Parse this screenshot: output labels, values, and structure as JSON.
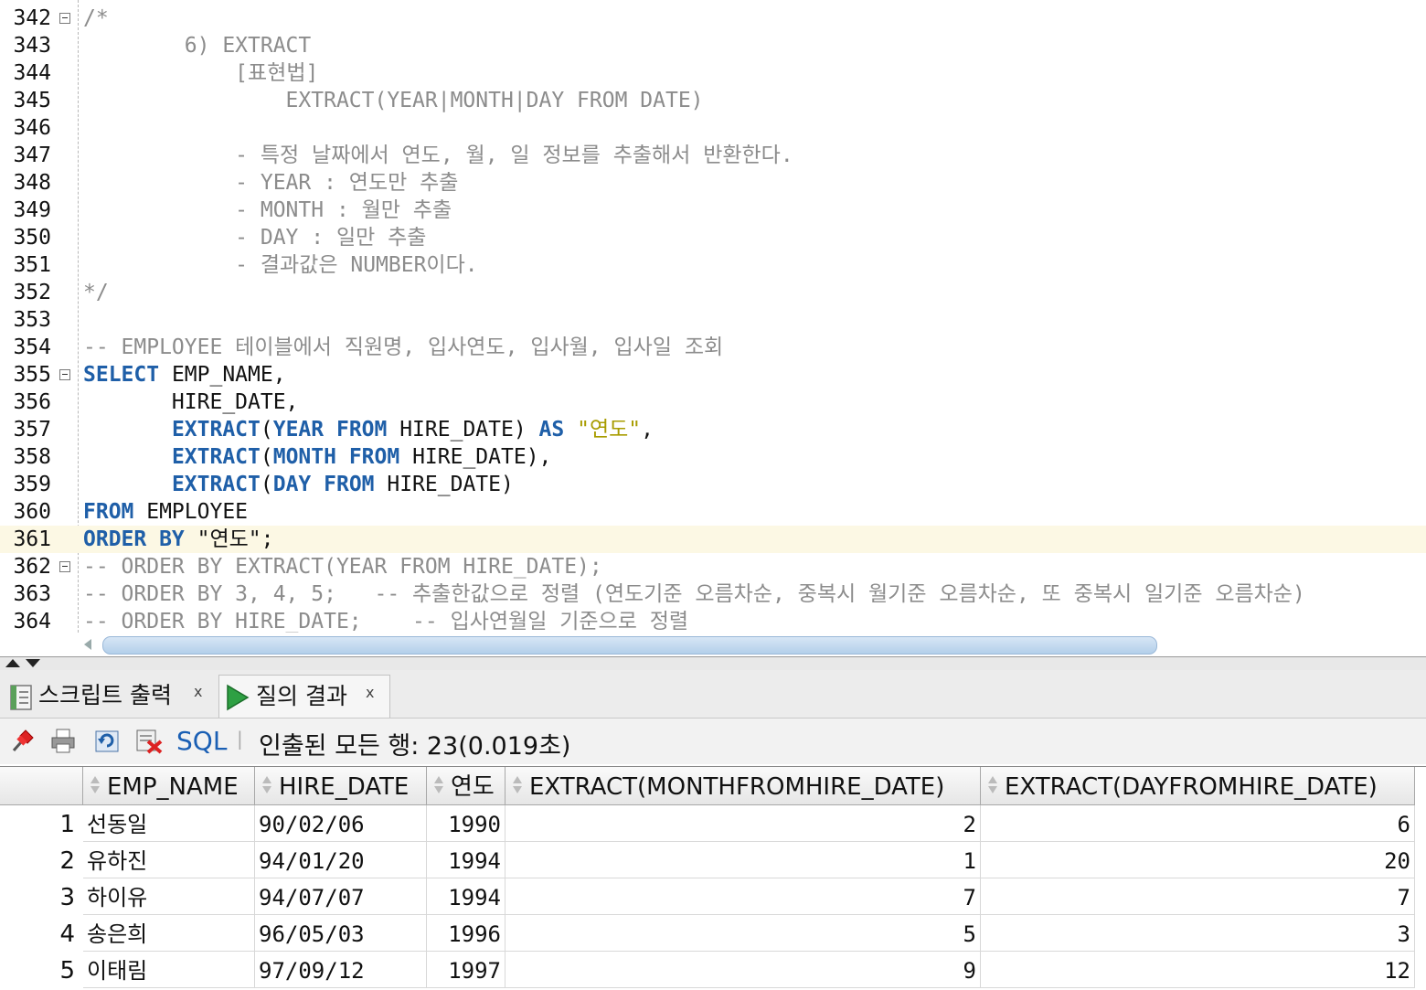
{
  "editor": {
    "lines": [
      {
        "n": "342",
        "fold": true,
        "parts": [
          {
            "t": "/*",
            "c": "cm"
          }
        ]
      },
      {
        "n": "343",
        "parts": [
          {
            "t": "        6) EXTRACT",
            "c": "cm"
          }
        ]
      },
      {
        "n": "344",
        "parts": [
          {
            "t": "            [표현법]",
            "c": "cm"
          }
        ]
      },
      {
        "n": "345",
        "parts": [
          {
            "t": "                EXTRACT(YEAR|MONTH|DAY FROM DATE)",
            "c": "cm"
          }
        ]
      },
      {
        "n": "346",
        "parts": []
      },
      {
        "n": "347",
        "parts": [
          {
            "t": "            - 특정 날짜에서 연도, 월, 일 정보를 추출해서 반환한다.",
            "c": "cm"
          }
        ]
      },
      {
        "n": "348",
        "parts": [
          {
            "t": "            - YEAR : 연도만 추출",
            "c": "cm"
          }
        ]
      },
      {
        "n": "349",
        "parts": [
          {
            "t": "            - MONTH : 월만 추출",
            "c": "cm"
          }
        ]
      },
      {
        "n": "350",
        "parts": [
          {
            "t": "            - DAY : 일만 추출",
            "c": "cm"
          }
        ]
      },
      {
        "n": "351",
        "parts": [
          {
            "t": "            - 결과값은 NUMBER이다.",
            "c": "cm"
          }
        ]
      },
      {
        "n": "352",
        "parts": [
          {
            "t": "*/",
            "c": "cm"
          }
        ]
      },
      {
        "n": "353",
        "parts": []
      },
      {
        "n": "354",
        "parts": [
          {
            "t": "-- EMPLOYEE 테이블에서 직원명, 입사연도, 입사월, 입사일 조회",
            "c": "cm"
          }
        ]
      },
      {
        "n": "355",
        "fold": true,
        "parts": [
          {
            "t": "SELECT",
            "c": "kw"
          },
          {
            "t": " EMP_NAME,",
            "c": "tx"
          }
        ]
      },
      {
        "n": "356",
        "parts": [
          {
            "t": "       HIRE_DATE,",
            "c": "tx"
          }
        ]
      },
      {
        "n": "357",
        "parts": [
          {
            "t": "       ",
            "c": "tx"
          },
          {
            "t": "EXTRACT",
            "c": "kw"
          },
          {
            "t": "(",
            "c": "tx"
          },
          {
            "t": "YEAR FROM",
            "c": "kw"
          },
          {
            "t": " HIRE_DATE) ",
            "c": "tx"
          },
          {
            "t": "AS",
            "c": "kw"
          },
          {
            "t": " ",
            "c": "tx"
          },
          {
            "t": "\"연도\"",
            "c": "str"
          },
          {
            "t": ",",
            "c": "tx"
          }
        ]
      },
      {
        "n": "358",
        "parts": [
          {
            "t": "       ",
            "c": "tx"
          },
          {
            "t": "EXTRACT",
            "c": "kw"
          },
          {
            "t": "(",
            "c": "tx"
          },
          {
            "t": "MONTH FROM",
            "c": "kw"
          },
          {
            "t": " HIRE_DATE),",
            "c": "tx"
          }
        ]
      },
      {
        "n": "359",
        "parts": [
          {
            "t": "       ",
            "c": "tx"
          },
          {
            "t": "EXTRACT",
            "c": "kw"
          },
          {
            "t": "(",
            "c": "tx"
          },
          {
            "t": "DAY FROM",
            "c": "kw"
          },
          {
            "t": " HIRE_DATE)",
            "c": "tx"
          }
        ]
      },
      {
        "n": "360",
        "parts": [
          {
            "t": "FROM",
            "c": "kw"
          },
          {
            "t": " EMPLOYEE",
            "c": "tx"
          }
        ]
      },
      {
        "n": "361",
        "cur": true,
        "parts": [
          {
            "t": "ORDER BY",
            "c": "kw"
          },
          {
            "t": " \"연도\";",
            "c": "tx"
          }
        ]
      },
      {
        "n": "362",
        "fold": true,
        "parts": [
          {
            "t": "-- ORDER BY EXTRACT(YEAR FROM HIRE_DATE);",
            "c": "cm"
          }
        ]
      },
      {
        "n": "363",
        "parts": [
          {
            "t": "-- ORDER BY 3, 4, 5;   -- 추출한값으로 정렬 (연도기준 오름차순, 중복시 월기준 오름차순, 또 중복시 일기준 오름차순)",
            "c": "cm"
          }
        ]
      },
      {
        "n": "364",
        "parts": [
          {
            "t": "-- ORDER BY HIRE_DATE;    -- 입사연월일 기준으로 정렬",
            "c": "cm"
          }
        ]
      }
    ]
  },
  "tabs": [
    {
      "label": "스크립트 출력",
      "close": "x"
    },
    {
      "label": "질의 결과",
      "close": "x"
    }
  ],
  "toolbar": {
    "sql_label": "SQL",
    "separator": "|",
    "status": "인출된 모든 행: 23(0.019초)"
  },
  "grid": {
    "columns": [
      "EMP_NAME",
      "HIRE_DATE",
      "연도",
      "EXTRACT(MONTHFROMHIRE_DATE)",
      "EXTRACT(DAYFROMHIRE_DATE)"
    ],
    "rows": [
      [
        "1",
        "선동일",
        "90/02/06",
        "1990",
        "2",
        "6"
      ],
      [
        "2",
        "유하진",
        "94/01/20",
        "1994",
        "1",
        "20"
      ],
      [
        "3",
        "하이유",
        "94/07/07",
        "1994",
        "7",
        "7"
      ],
      [
        "4",
        "송은희",
        "96/05/03",
        "1996",
        "5",
        "3"
      ],
      [
        "5",
        "이태림",
        "97/09/12",
        "1997",
        "9",
        "12"
      ]
    ]
  },
  "colors": {
    "keyword": "#1f5fa8",
    "comment": "#8c8c8c",
    "string": "#a89c00",
    "link": "#1a5fb4"
  }
}
